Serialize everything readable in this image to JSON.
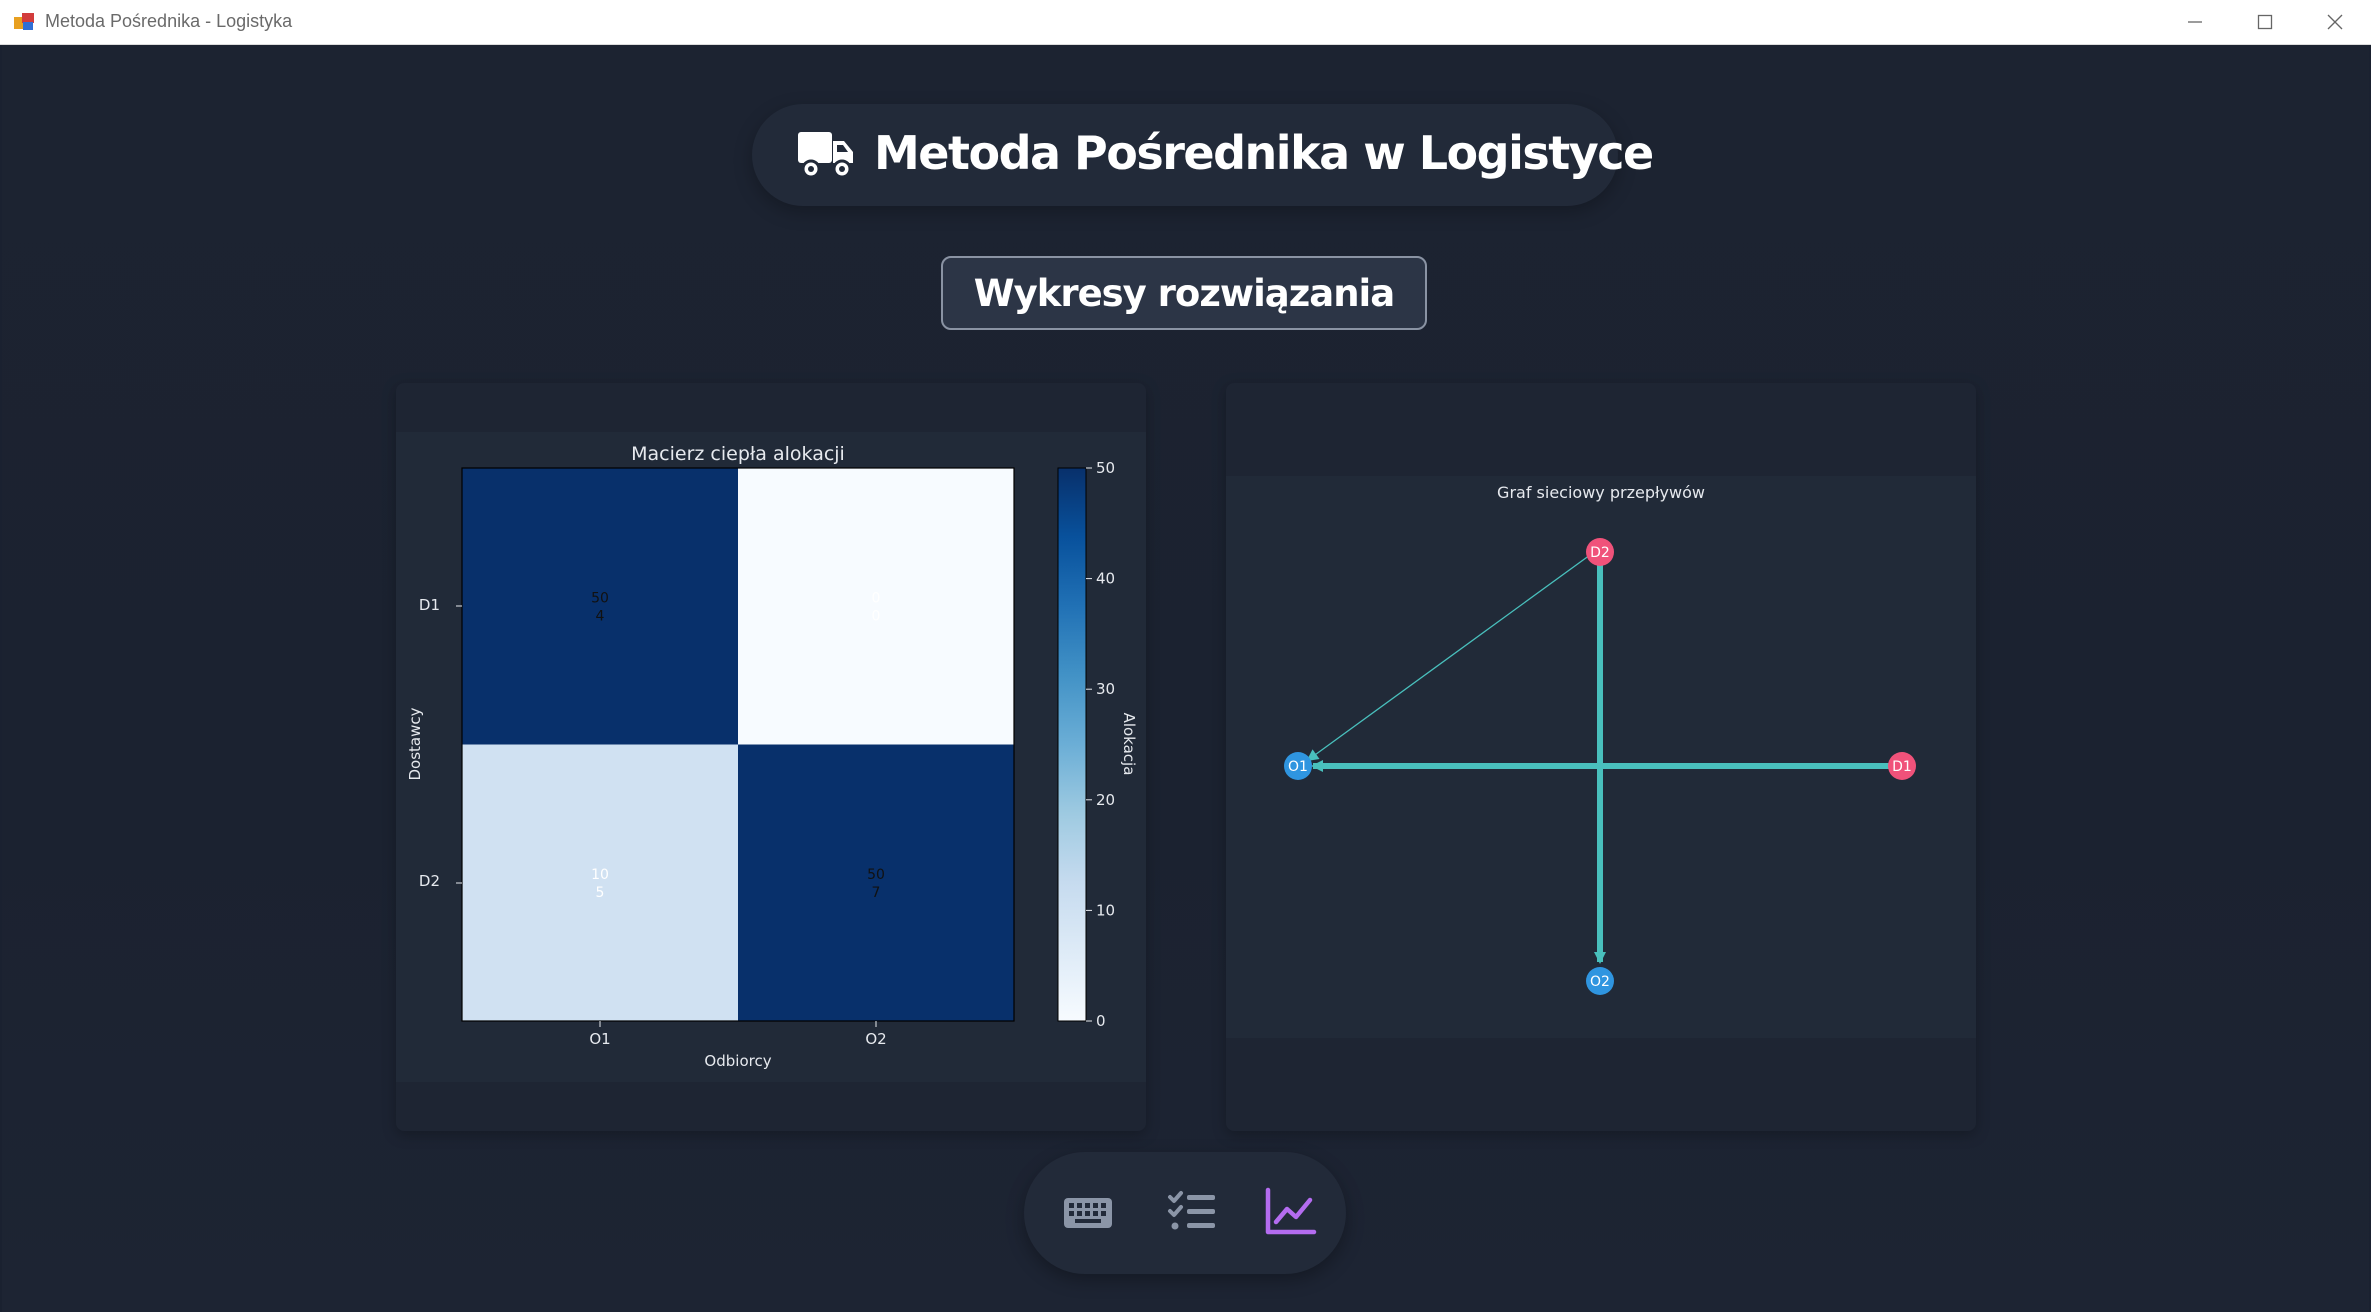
{
  "window": {
    "title": "Metoda Pośrednika - Logistyka"
  },
  "header": {
    "title": "Metoda Pośrednika w Logistyce",
    "icon": "truck-icon"
  },
  "section_button": {
    "label": "Wykresy rozwiązania"
  },
  "heatmap": {
    "title": "Macierz ciepła alokacji",
    "xlabel": "Odbiorcy",
    "ylabel": "Dostawcy",
    "colorbar_label": "Alokacja",
    "x_ticks": [
      "O1",
      "O2"
    ],
    "y_ticks": [
      "D1",
      "D2"
    ],
    "colorbar_ticks": [
      "50",
      "40",
      "30",
      "20",
      "10",
      "0"
    ],
    "cells": [
      [
        {
          "alloc": "50",
          "cost": "4"
        },
        {
          "alloc": "0",
          "cost": "0"
        }
      ],
      [
        {
          "alloc": "10",
          "cost": "5"
        },
        {
          "alloc": "50",
          "cost": "7"
        }
      ]
    ]
  },
  "network": {
    "title": "Graf sieciowy przepływów",
    "nodes": [
      {
        "id": "D2",
        "type": "supplier"
      },
      {
        "id": "O1",
        "type": "receiver"
      },
      {
        "id": "D1",
        "type": "supplier"
      },
      {
        "id": "O2",
        "type": "receiver"
      }
    ],
    "edges": [
      {
        "from": "D1",
        "to": "O1",
        "weight": "thick"
      },
      {
        "from": "D2",
        "to": "O2",
        "weight": "thick"
      },
      {
        "from": "D2",
        "to": "O1",
        "weight": "thin"
      }
    ]
  },
  "chart_data": [
    {
      "type": "heatmap",
      "title": "Macierz ciepła alokacji",
      "xlabel": "Odbiorcy",
      "ylabel": "Dostawcy",
      "x": [
        "O1",
        "O2"
      ],
      "y": [
        "D1",
        "D2"
      ],
      "values": [
        [
          50,
          0
        ],
        [
          10,
          50
        ]
      ],
      "annotations": [
        [
          "50\n4",
          "0\n0"
        ],
        [
          "10\n5",
          "50\n7"
        ]
      ],
      "colorbar": {
        "label": "Alokacja",
        "range": [
          0,
          50
        ],
        "ticks": [
          0,
          10,
          20,
          30,
          40,
          50
        ]
      },
      "colormap": "Blues"
    }
  ],
  "bottom_nav": {
    "items": [
      {
        "name": "keyboard-icon",
        "active": false
      },
      {
        "name": "checklist-icon",
        "active": false
      },
      {
        "name": "chart-line-icon",
        "active": true
      }
    ]
  },
  "colors": {
    "background": "#1b2230",
    "accent_active": "#b46cf0",
    "node_supplier": "#f0527a",
    "node_receiver": "#2f95e0",
    "edge": "#49c0bd",
    "heat_high": "#08306b",
    "heat_low": "#f7fbff"
  }
}
